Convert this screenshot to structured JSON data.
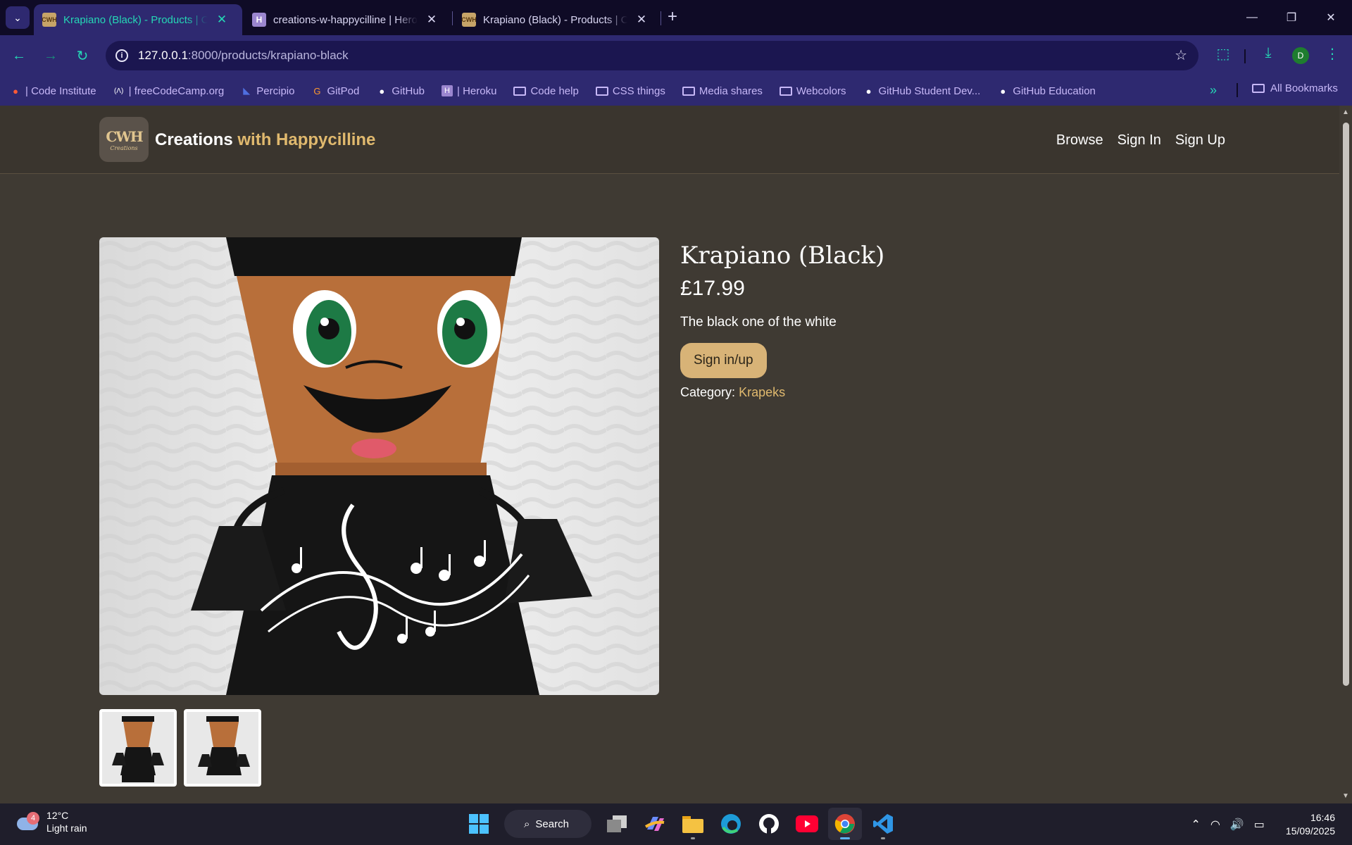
{
  "browser": {
    "tabs": [
      {
        "title": "Krapiano (Black) - Products | Creations with Happycilline",
        "favicon": "CWH",
        "active": true
      },
      {
        "title": "creations-w-happycilline | Heroku",
        "favicon": "H",
        "active": false
      },
      {
        "title": "Krapiano (Black) - Products | Creations with Happycilline",
        "favicon": "CWH",
        "active": false
      }
    ],
    "url_host": "127.0.0.1",
    "url_path": ":8000/products/krapiano-black",
    "profile_initial": "D",
    "bookmarks": [
      {
        "label": "| Code Institute",
        "icon": "code-institute-icon"
      },
      {
        "label": "| freeCodeCamp.org",
        "icon": "freecodecamp-icon"
      },
      {
        "label": "Percipio",
        "icon": "percipio-icon"
      },
      {
        "label": "GitPod",
        "icon": "gitpod-icon"
      },
      {
        "label": "GitHub",
        "icon": "github-icon"
      },
      {
        "label": "| Heroku",
        "icon": "heroku-icon"
      },
      {
        "label": "Code help",
        "icon": "folder-icon"
      },
      {
        "label": "CSS things",
        "icon": "folder-icon"
      },
      {
        "label": "Media shares",
        "icon": "folder-icon"
      },
      {
        "label": "Webcolors",
        "icon": "folder-icon"
      },
      {
        "label": "GitHub Student Dev...",
        "icon": "github-icon"
      },
      {
        "label": "GitHub Education",
        "icon": "github-icon"
      }
    ],
    "all_bookmarks": "All Bookmarks",
    "colors": {
      "chrome_bg": "#2e2970",
      "accent": "#25d7b5"
    }
  },
  "site": {
    "logo_mark": "CWH",
    "logo_sub": "Creations",
    "brand_main": "Creations",
    "brand_accent": "with Happycilline",
    "nav": [
      "Browse",
      "Sign In",
      "Sign Up"
    ],
    "colors": {
      "page_bg": "#3f3a33",
      "accent": "#e0b96e",
      "button_bg": "#d8b377"
    }
  },
  "product": {
    "title": "Krapiano (Black)",
    "price": "£17.99",
    "description": "The black one of the white",
    "cta_label": "Sign in/up",
    "category_label": "Category:",
    "category_value": "Krapeks",
    "thumbnail_count": 2
  },
  "taskbar": {
    "weather_badge": "4",
    "temperature": "12°C",
    "condition": "Light rain",
    "search_label": "Search",
    "time": "16:46",
    "date": "15/09/2025"
  }
}
